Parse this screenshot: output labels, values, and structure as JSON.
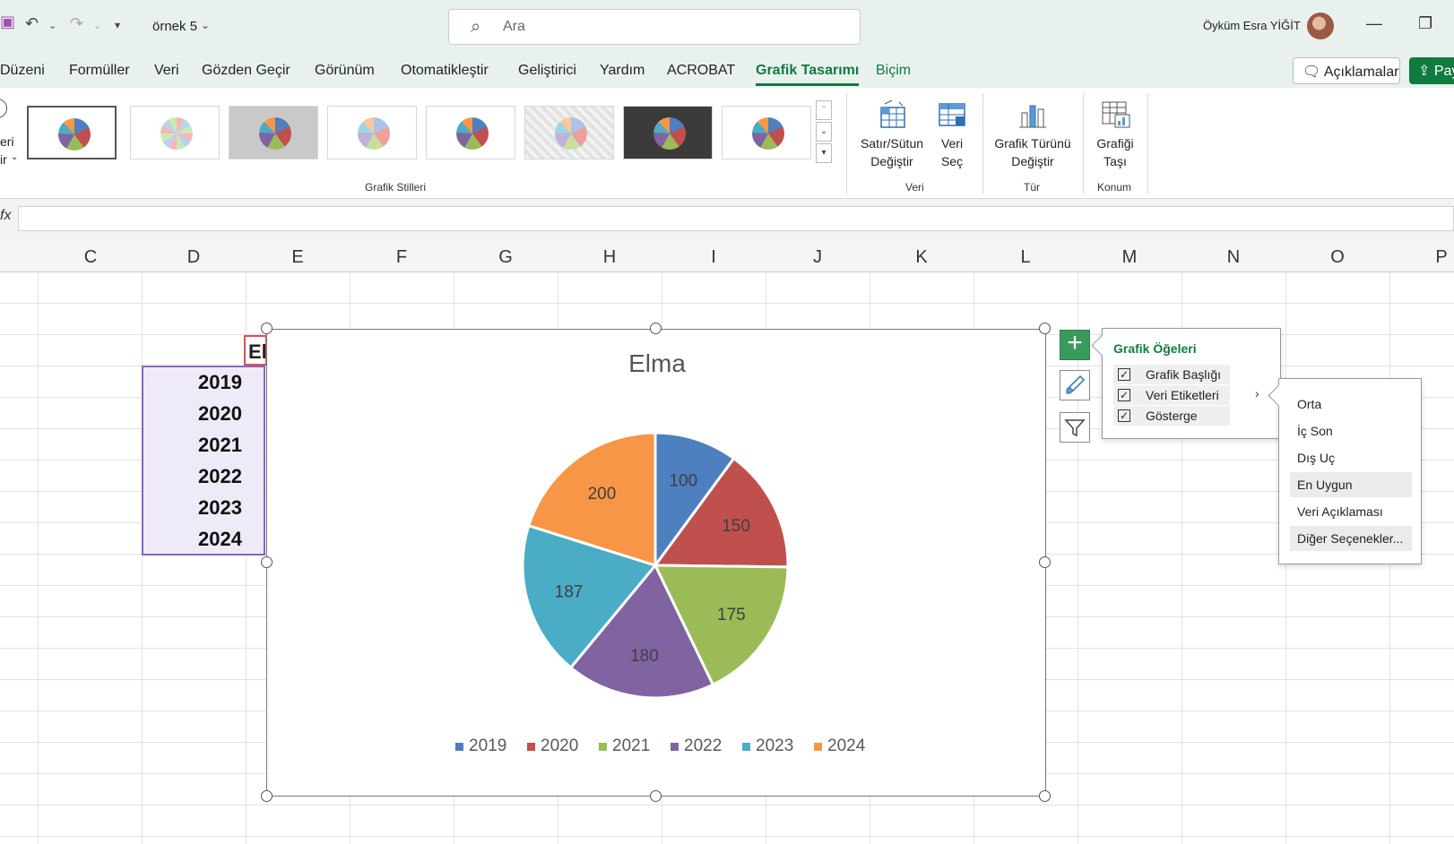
{
  "colors": {
    "accent": "#0f7b3f",
    "selection": "#8a63c5"
  },
  "titlebar": {
    "doc_name": "örnek 5",
    "search_placeholder": "Ara",
    "user_name": "Öyküm Esra YİĞİT"
  },
  "tabs": [
    {
      "label": "Düzeni"
    },
    {
      "label": "Formüller"
    },
    {
      "label": "Veri"
    },
    {
      "label": "Gözden Geçir"
    },
    {
      "label": "Görünüm"
    },
    {
      "label": "Otomatikleştir"
    },
    {
      "label": "Geliştirici"
    },
    {
      "label": "Yardım"
    },
    {
      "label": "ACROBAT"
    },
    {
      "label": "Grafik Tasarımı"
    },
    {
      "label": "Biçim"
    }
  ],
  "header_buttons": {
    "comments": "Açıklamalar",
    "share": "Pay"
  },
  "ribbon": {
    "left_partial": [
      "eri",
      "ir"
    ],
    "gallery_label": "Grafik Stilleri",
    "groups": {
      "veri": {
        "label": "Veri",
        "switch": [
          "Satır/Sütun",
          "Değiştir"
        ],
        "select": [
          "Veri",
          "Seç"
        ]
      },
      "tur": {
        "label": "Tür",
        "change": [
          "Grafik Türünü",
          "Değiştir"
        ]
      },
      "konum": {
        "label": "Konum",
        "move": [
          "Grafiği",
          "Taşı"
        ]
      }
    }
  },
  "formula_bar": {
    "fx": "fx",
    "value": ""
  },
  "columns": [
    "C",
    "D",
    "E",
    "F",
    "G",
    "H",
    "I",
    "J",
    "K",
    "L",
    "M",
    "N",
    "O",
    "P"
  ],
  "cells": {
    "e_header": "El",
    "years": [
      "2019",
      "2020",
      "2021",
      "2022",
      "2023",
      "2024"
    ]
  },
  "chart_data": {
    "type": "pie",
    "title": "Elma",
    "categories": [
      "2019",
      "2020",
      "2021",
      "2022",
      "2023",
      "2024"
    ],
    "values": [
      100,
      150,
      175,
      180,
      187,
      200
    ],
    "colors": [
      "#4e7fbf",
      "#c0504d",
      "#9bbb59",
      "#8064a2",
      "#4bacc6",
      "#f79646"
    ],
    "data_labels": true,
    "legend": "bottom"
  },
  "chart_elements": {
    "title": "Grafik Öğeleri",
    "items": [
      {
        "label": "Grafik Başlığı",
        "checked": true
      },
      {
        "label": "Veri Etiketleri",
        "checked": true
      },
      {
        "label": "Gösterge",
        "checked": true
      }
    ],
    "check_mark": "✓"
  },
  "label_positions": {
    "items": [
      "Orta",
      "İç Son",
      "Dış Uç",
      "En Uygun",
      "Veri Açıklaması",
      "Diğer Seçenekler..."
    ],
    "highlighted": [
      "En Uygun",
      "Diğer Seçenekler..."
    ]
  }
}
